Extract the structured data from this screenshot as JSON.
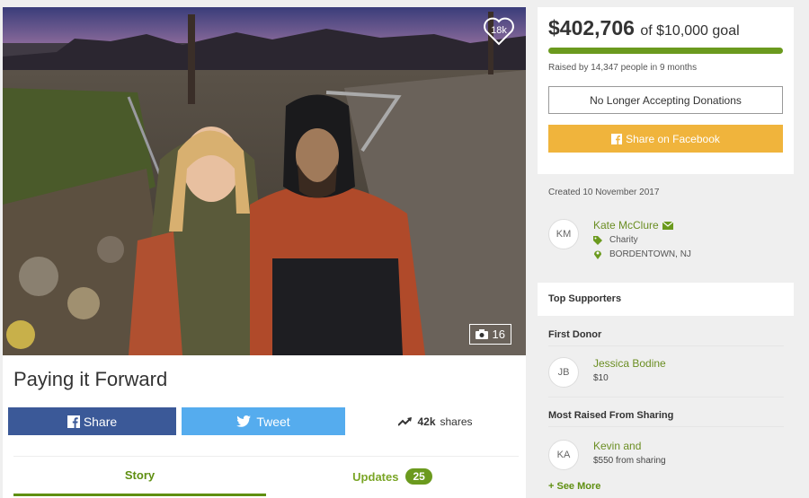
{
  "hero": {
    "heart_count": "18k",
    "photo_count": "16"
  },
  "campaign": {
    "title": "Paying it Forward"
  },
  "share": {
    "facebook_label": "Share",
    "twitter_label": "Tweet",
    "shares_count": "42k",
    "shares_label": "shares"
  },
  "tabs": {
    "story": "Story",
    "updates": "Updates",
    "updates_count": "25"
  },
  "donation": {
    "amount": "$402,706",
    "goal_text": "of $10,000 goal",
    "progress_fraction": 1.0,
    "raised_text": "Raised by 14,347 people in 9 months",
    "no_longer_label": "No Longer Accepting Donations",
    "share_facebook_label": "Share on Facebook"
  },
  "organizer": {
    "created": "Created 10 November 2017",
    "initials": "KM",
    "name": "Kate McClure",
    "category": "Charity",
    "location": "BORDENTOWN, NJ"
  },
  "supporters": {
    "heading": "Top Supporters",
    "first_donor_heading": "First Donor",
    "first_donor": {
      "initials": "JB",
      "name": "Jessica Bodine",
      "amount": "$10"
    },
    "most_raised_heading": "Most Raised From Sharing",
    "most_raised": {
      "initials": "KA",
      "name": "Kevin and",
      "amount": "$550 from sharing"
    },
    "see_more": "+ See More"
  },
  "colors": {
    "brand_green": "#6b9a1e",
    "facebook_blue": "#3b5998",
    "twitter_blue": "#55acee",
    "share_orange": "#f0b43c"
  }
}
